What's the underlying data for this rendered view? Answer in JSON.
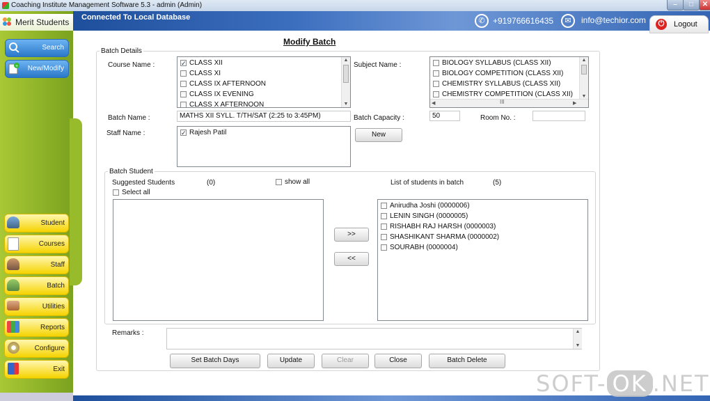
{
  "window": {
    "title": "Coaching Institute Management Software 5.3  -  admin (Admin)"
  },
  "header": {
    "connection": "Connected To  Local Database",
    "phone": "+919766616435",
    "email": "info@techior.com",
    "logout_label": "Logout"
  },
  "sidebar": {
    "brand": "Merit Students",
    "search_label": "Search",
    "new_modify_label": "New/Modify",
    "menu": [
      {
        "label": "Student",
        "icon": "students-icon"
      },
      {
        "label": "Courses",
        "icon": "document-icon"
      },
      {
        "label": "Staff",
        "icon": "staff-icon"
      },
      {
        "label": "Batch",
        "icon": "batch-icon"
      },
      {
        "label": "Utilities",
        "icon": "toolbox-icon"
      },
      {
        "label": "Reports",
        "icon": "reports-icon"
      },
      {
        "label": "Configure",
        "icon": "gear-icon"
      },
      {
        "label": "Exit",
        "icon": "exit-icon"
      }
    ]
  },
  "form": {
    "title": "Modify Batch",
    "batch_details_label": "Batch Details",
    "course_name_label": "Course Name :",
    "courses": [
      {
        "label": "CLASS XII",
        "checked": true
      },
      {
        "label": "CLASS XI",
        "checked": false
      },
      {
        "label": "CLASS IX AFTERNOON",
        "checked": false
      },
      {
        "label": "CLASS IX EVENING",
        "checked": false
      },
      {
        "label": "CLASS X AFTERNOON",
        "checked": false
      }
    ],
    "subject_name_label": "Subject Name :",
    "subjects": [
      {
        "label": "BIOLOGY SYLLABUS (CLASS XII)",
        "checked": false
      },
      {
        "label": "BIOLOGY COMPETITION (CLASS XII)",
        "checked": false
      },
      {
        "label": "CHEMISTRY SYLLABUS (CLASS XII)",
        "checked": false
      },
      {
        "label": "CHEMISTRY COMPETITION (CLASS XII)",
        "checked": false
      }
    ],
    "hscroll_thumb": "III",
    "batch_name_label": "Batch Name :",
    "batch_name_value": "MATHS XII SYLL. T/TH/SAT (2:25 to 3:45PM)",
    "batch_capacity_label": "Batch Capacity :",
    "batch_capacity_value": "50",
    "room_no_label": "Room No. :",
    "room_no_value": "",
    "staff_name_label": "Staff Name  :",
    "staff": [
      {
        "label": "Rajesh  Patil",
        "checked": true
      }
    ],
    "new_button": "New"
  },
  "batch_student": {
    "label": "Batch Student",
    "suggested_label": "Suggested Students",
    "suggested_count": "(0)",
    "show_all_label": "show all",
    "select_all_label": "Select all",
    "in_batch_label": "List of students in batch",
    "in_batch_count": "(5)",
    "add_button": ">>",
    "remove_button": "<<",
    "students": [
      {
        "label": "Anirudha  Joshi (0000006)",
        "checked": false
      },
      {
        "label": "LENIN SINGH  (0000005)",
        "checked": false
      },
      {
        "label": "RISHABH RAJ HARSH (0000003)",
        "checked": false
      },
      {
        "label": "SHASHIKANT SHARMA  (0000002)",
        "checked": false
      },
      {
        "label": "SOURABH  (0000004)",
        "checked": false
      }
    ]
  },
  "remarks": {
    "label": "Remarks :",
    "value": ""
  },
  "actions": {
    "set_batch_days": "Set Batch Days",
    "update": "Update",
    "clear": "Clear",
    "close": "Close",
    "batch_delete": "Batch Delete"
  },
  "watermark": {
    "left": "SOFT-",
    "ok": "OK",
    "right": ".NET"
  }
}
